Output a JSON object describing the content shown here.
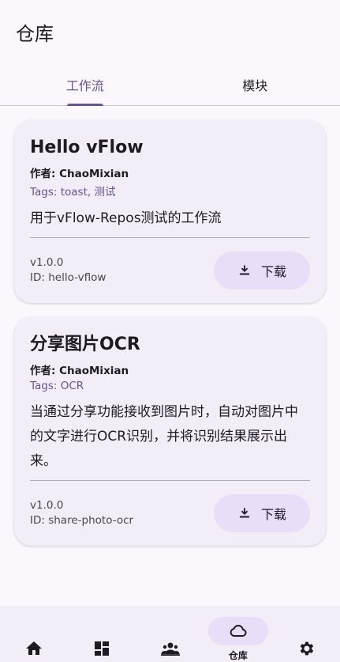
{
  "app": {
    "title": "仓库"
  },
  "tabs": [
    {
      "label": "工作流",
      "active": true
    },
    {
      "label": "模块",
      "active": false
    }
  ],
  "cards": [
    {
      "title": "Hello vFlow",
      "author": "作者: ChaoMixian",
      "tags": "Tags: toast, 测试",
      "description": "用于vFlow-Repos测试的工作流",
      "version": "v1.0.0",
      "id": "ID: hello-vflow",
      "download_label": "下载"
    },
    {
      "title": "分享图片OCR",
      "author": "作者: ChaoMixian",
      "tags": "Tags: OCR",
      "description": "当通过分享功能接收到图片时，自动对图片中的文字进行OCR识别，并将识别结果展示出来。",
      "version": "v1.0.0",
      "id": "ID: share-photo-ocr",
      "download_label": "下载"
    }
  ],
  "bottom_nav": {
    "items": [
      {
        "icon": "home-icon"
      },
      {
        "icon": "dashboard-icon"
      },
      {
        "icon": "people-icon"
      },
      {
        "icon": "cloud-icon",
        "label": "仓库",
        "active": true
      },
      {
        "icon": "settings-icon"
      }
    ]
  },
  "colors": {
    "background": "#fbf7fd",
    "accent": "#65558f",
    "card": "#f3edf7",
    "button": "#e8def8"
  }
}
